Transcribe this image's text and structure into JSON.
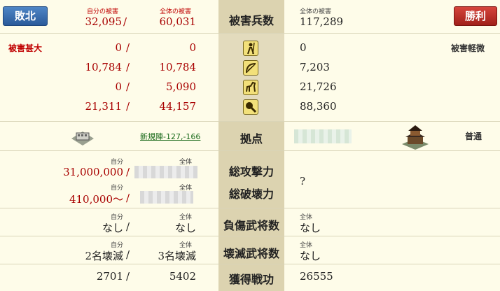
{
  "header": {
    "defeat_label": "敗北",
    "victory_label": "勝利",
    "self_damage_caption": "自分の被害",
    "total_damage_caption": "全体の被害",
    "self_damage_value": "32,095",
    "total_damage_value": "60,031",
    "center_label": "被害兵数",
    "enemy_caption": "全体の被害",
    "enemy_value": "117,289"
  },
  "units": {
    "left_tag": "被害甚大",
    "right_tag": "被害軽微",
    "rows": [
      {
        "icon": "spear-icon",
        "self": "0",
        "total": "0",
        "enemy": "0"
      },
      {
        "icon": "bow-icon",
        "self": "10,784",
        "total": "10,784",
        "enemy": "7,203"
      },
      {
        "icon": "horse-icon",
        "self": "0",
        "total": "5,090",
        "enemy": "21,726"
      },
      {
        "icon": "siege-icon",
        "self": "21,311",
        "total": "44,157",
        "enemy": "88,360"
      }
    ]
  },
  "base": {
    "label": "拠点",
    "coord_link": "新規陣-127,-166",
    "right_tag": "普通"
  },
  "power": {
    "attack_label": "総攻撃力",
    "destroy_label": "総破壊力",
    "self_caption": "自分",
    "total_caption": "全体",
    "attack_self": "31,000,000",
    "destroy_self": "410,000～",
    "enemy_value": "?"
  },
  "injured": {
    "label": "負傷武将数",
    "self_caption": "自分",
    "total_caption": "全体",
    "self_value": "なし",
    "total_value": "なし",
    "enemy_caption": "全体",
    "enemy_value": "なし"
  },
  "destroyed": {
    "label": "壊滅武将数",
    "self_caption": "自分",
    "total_caption": "全体",
    "self_value": "2名壊滅",
    "total_value": "3名壊滅",
    "enemy_caption": "全体",
    "enemy_value": "なし"
  },
  "merit": {
    "label": "獲得戦功",
    "self_value": "2701",
    "total_value": "5402",
    "enemy_value": "26555"
  },
  "slash": "/",
  "colors": {
    "defeat": "#2a5a9a",
    "victory": "#a0201a",
    "loss_text": "#a80000",
    "center_col": "#dcd3b0"
  }
}
